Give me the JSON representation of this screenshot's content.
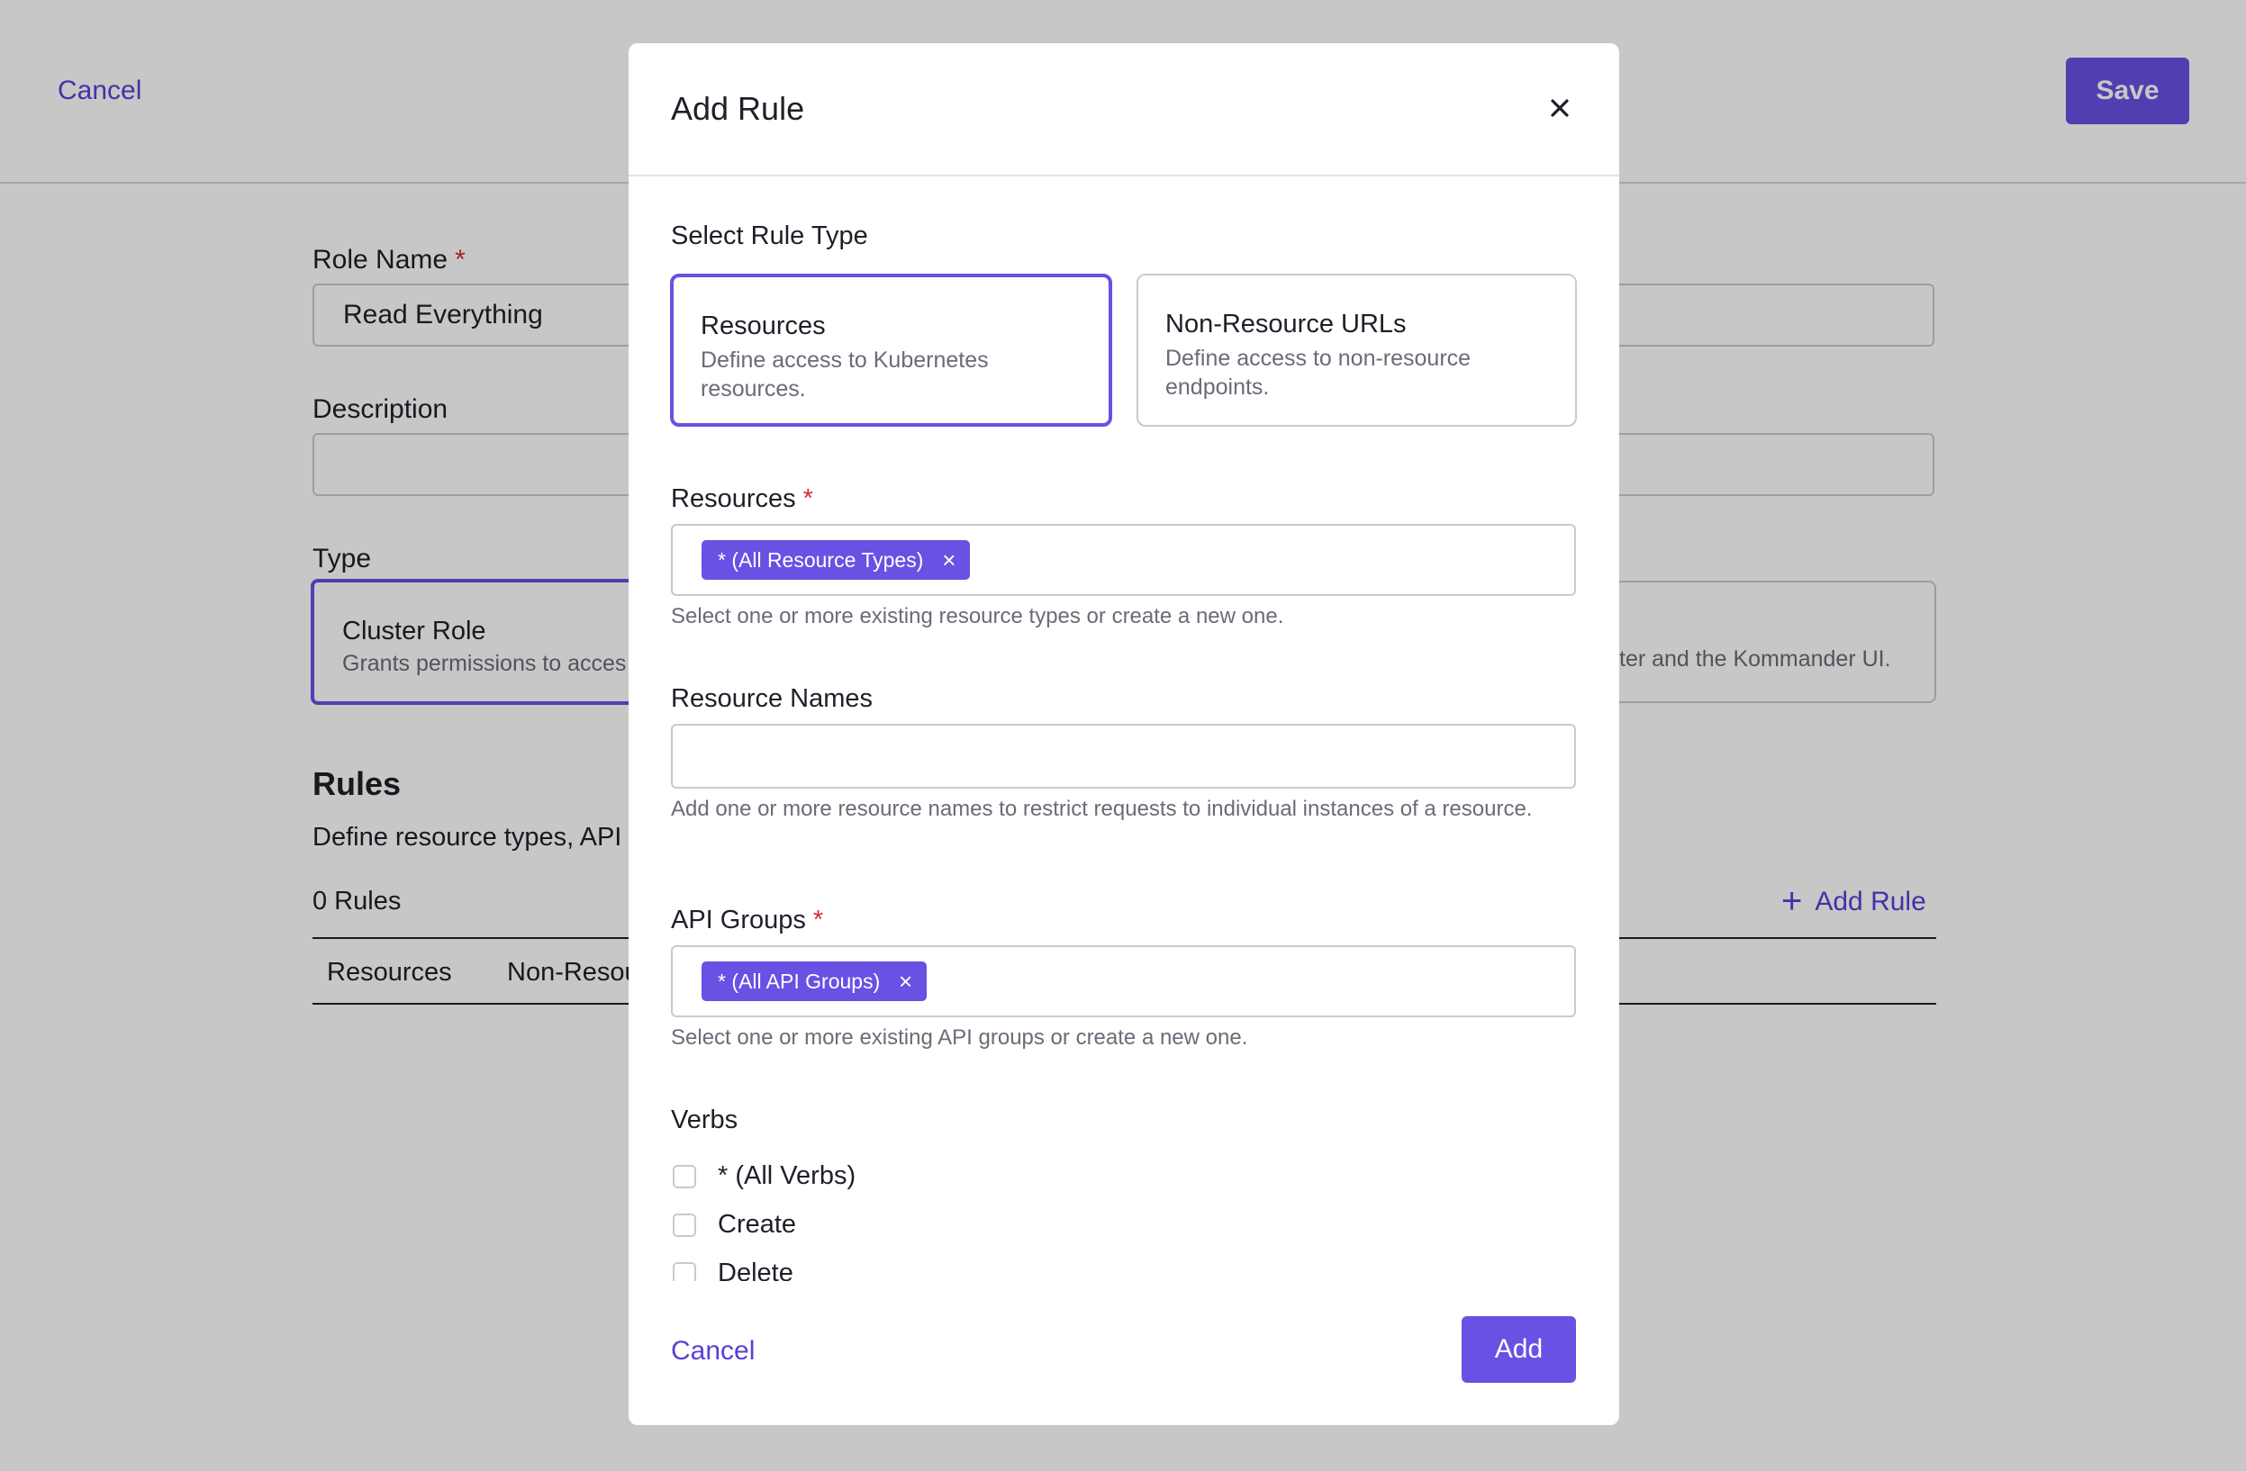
{
  "page": {
    "cancel_label": "Cancel",
    "save_label": "Save",
    "role_name": {
      "label": "Role Name",
      "required": "*",
      "value": "Read Everything"
    },
    "description": {
      "label": "Description",
      "value": ""
    },
    "type": {
      "label": "Type",
      "cards": [
        {
          "title": "Cluster Role",
          "desc": "Grants permissions to acces"
        },
        {
          "desc": "ter and the Kommander UI."
        }
      ]
    },
    "rules": {
      "heading": "Rules",
      "subtitle": "Define resource types, API",
      "count": "0 Rules",
      "add_rule_label": "Add Rule",
      "columns": [
        "Resources",
        "Non-Resou"
      ]
    }
  },
  "modal": {
    "title": "Add Rule",
    "rule_type_label": "Select Rule Type",
    "rule_types": [
      {
        "title": "Resources",
        "desc": "Define access to Kubernetes resources.",
        "selected": true
      },
      {
        "title": "Non-Resource URLs",
        "desc": "Define access to non-resource endpoints.",
        "selected": false
      }
    ],
    "resources": {
      "label": "Resources",
      "required": "*",
      "chip": "* (All Resource Types)",
      "help": "Select one or more existing resource types or create a new one."
    },
    "resource_names": {
      "label": "Resource Names",
      "value": "",
      "help": "Add one or more resource names to restrict requests to individual instances of a resource."
    },
    "api_groups": {
      "label": "API Groups",
      "required": "*",
      "chip": "* (All API Groups)",
      "help": "Select one or more existing API groups or create a new one."
    },
    "verbs": {
      "label": "Verbs",
      "items": [
        "* (All Verbs)",
        "Create",
        "Delete"
      ]
    },
    "cancel_label": "Cancel",
    "add_label": "Add"
  },
  "colors": {
    "accent": "#6a50e3",
    "link": "#5a3ed6",
    "required": "#d22c2c"
  }
}
